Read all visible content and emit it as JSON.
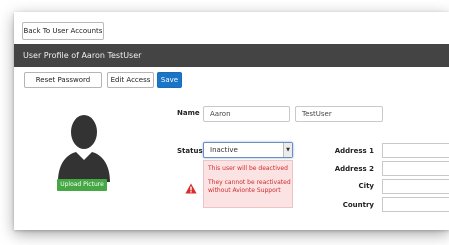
{
  "toolbar": {
    "back_label": "Back To User Accounts"
  },
  "header": {
    "title": "User Profile of Aaron TestUser"
  },
  "actions": {
    "reset_password": "Reset Password",
    "edit_access": "Edit Access",
    "save": "Save"
  },
  "avatar": {
    "upload_label": "Upload Picture"
  },
  "form": {
    "name_label": "Name",
    "first_name": "Aaron",
    "last_name": "TestUser",
    "status_label": "Status",
    "status_value": "Inactive",
    "status_error_1": "This user will be deactived",
    "status_error_2": "They cannot be reactivated without Avionte Support",
    "address1_label": "Address 1",
    "address2_label": "Address 2",
    "city_label": "City",
    "country_label": "Country"
  },
  "colors": {
    "header_bg": "#444444",
    "save_bg": "#1a75c7",
    "upload_bg": "#45a845",
    "error_text": "#cf2b2b",
    "error_bg": "#fbe3e3"
  },
  "icons": {
    "warning": "warning-icon",
    "select_caret": "chevron-down-icon",
    "avatar": "user-silhouette-icon"
  }
}
